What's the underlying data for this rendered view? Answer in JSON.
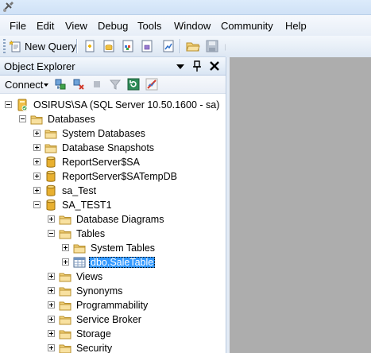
{
  "menu": {
    "items": [
      "File",
      "Edit",
      "View",
      "Debug",
      "Tools",
      "Window",
      "Community",
      "Help"
    ]
  },
  "toolbar": {
    "new_query_label": "New Query"
  },
  "object_explorer": {
    "title": "Object Explorer",
    "connect_label": "Connect",
    "tree": {
      "server": "OSIRUS\\SA (SQL Server 10.50.1600 - sa)",
      "databases": "Databases",
      "system_databases": "System Databases",
      "database_snapshots": "Database Snapshots",
      "reportserver_sa": "ReportServer$SA",
      "reportserver_sa_tempdb": "ReportServer$SATempDB",
      "sa_test": "sa_Test",
      "sa_test1": "SA_TEST1",
      "database_diagrams": "Database Diagrams",
      "tables": "Tables",
      "system_tables": "System Tables",
      "sale_table": "dbo.SaleTable",
      "views": "Views",
      "synonyms": "Synonyms",
      "programmability": "Programmability",
      "service_broker": "Service Broker",
      "storage": "Storage",
      "security": "Security"
    }
  },
  "colors": {
    "selection": "#3399ff",
    "document_area": "#adadad",
    "folder": "#f3d27a",
    "database": "#e8b030"
  }
}
